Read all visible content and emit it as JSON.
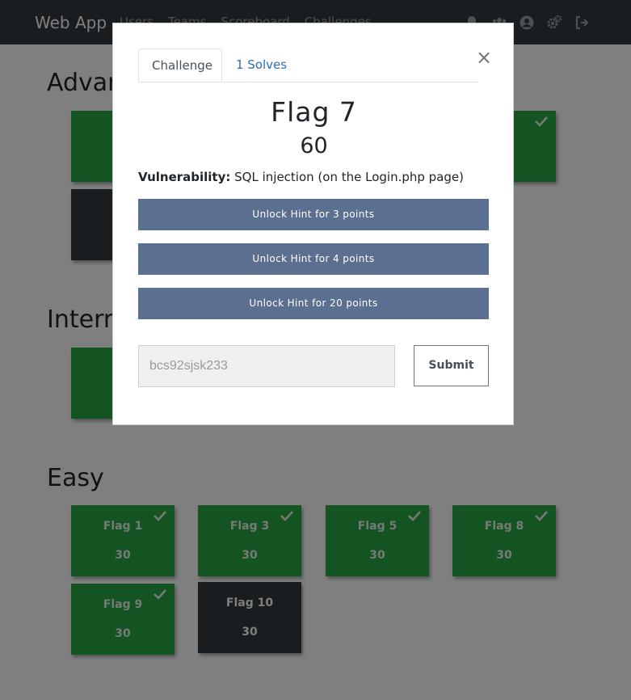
{
  "navbar": {
    "brand": "Web App",
    "links": [
      "Users",
      "Teams",
      "Scoreboard",
      "Challenges"
    ],
    "icons": [
      "bell-icon",
      "users-icon",
      "user-circle-icon",
      "cogs-icon",
      "sign-out-icon"
    ]
  },
  "sections": {
    "advanced": {
      "title": "Advanced"
    },
    "intermediate": {
      "title": "Intermediate"
    },
    "easy": {
      "title": "Easy",
      "tiles": [
        {
          "name": "Flag 1",
          "value": "30",
          "solved": true
        },
        {
          "name": "Flag 3",
          "value": "30",
          "solved": true
        },
        {
          "name": "Flag 5",
          "value": "30",
          "solved": true
        },
        {
          "name": "Flag 8",
          "value": "30",
          "solved": true
        },
        {
          "name": "Flag 9",
          "value": "30",
          "solved": true
        },
        {
          "name": "Flag 10",
          "value": "30",
          "solved": false
        }
      ]
    }
  },
  "modal": {
    "tabs": {
      "challenge": "Challenge",
      "solves": "1 Solves"
    },
    "close": "×",
    "title": "Flag 7",
    "value": "60",
    "description_label": "Vulnerability:",
    "description_text": " SQL injection (on the Login.php page)",
    "hints": [
      "Unlock Hint for 3 points",
      "Unlock Hint for 4 points",
      "Unlock Hint for 20 points"
    ],
    "flag_input_value": "bcs92sjsk233",
    "submit_label": "Submit"
  },
  "colors": {
    "navbar": "#343a40",
    "solved_tile": "#28a745",
    "unsolved_tile": "#343a40",
    "hint_button": "#5b7090",
    "tab_link": "#2f6db0"
  }
}
